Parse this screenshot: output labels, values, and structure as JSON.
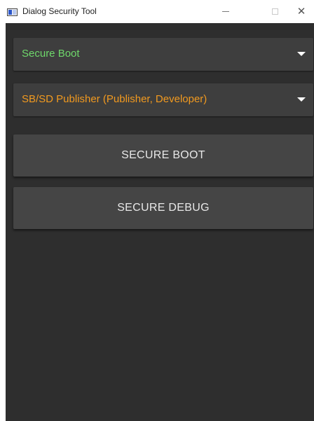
{
  "window": {
    "title": "Dialog Security Tool",
    "icon": "app-window-icon",
    "controls": {
      "minimize_icon": "minimize-icon",
      "maximize_icon": "maximize-icon",
      "close_icon": "close-icon",
      "close_glyph": "✕"
    }
  },
  "main": {
    "mode_dropdown": {
      "selected": "Secure Boot",
      "color": "#6fd86b"
    },
    "role_dropdown": {
      "selected": "SB/SD Publisher (Publisher, Developer)",
      "color": "#f29a1f"
    },
    "buttons": {
      "secure_boot_label": "SECURE BOOT",
      "secure_debug_label": "SECURE DEBUG"
    }
  },
  "colors": {
    "background": "#2e2e2e",
    "dropdown_bg": "#3e3e3e",
    "button_bg": "#454545",
    "button_text": "#e8e8e8"
  }
}
